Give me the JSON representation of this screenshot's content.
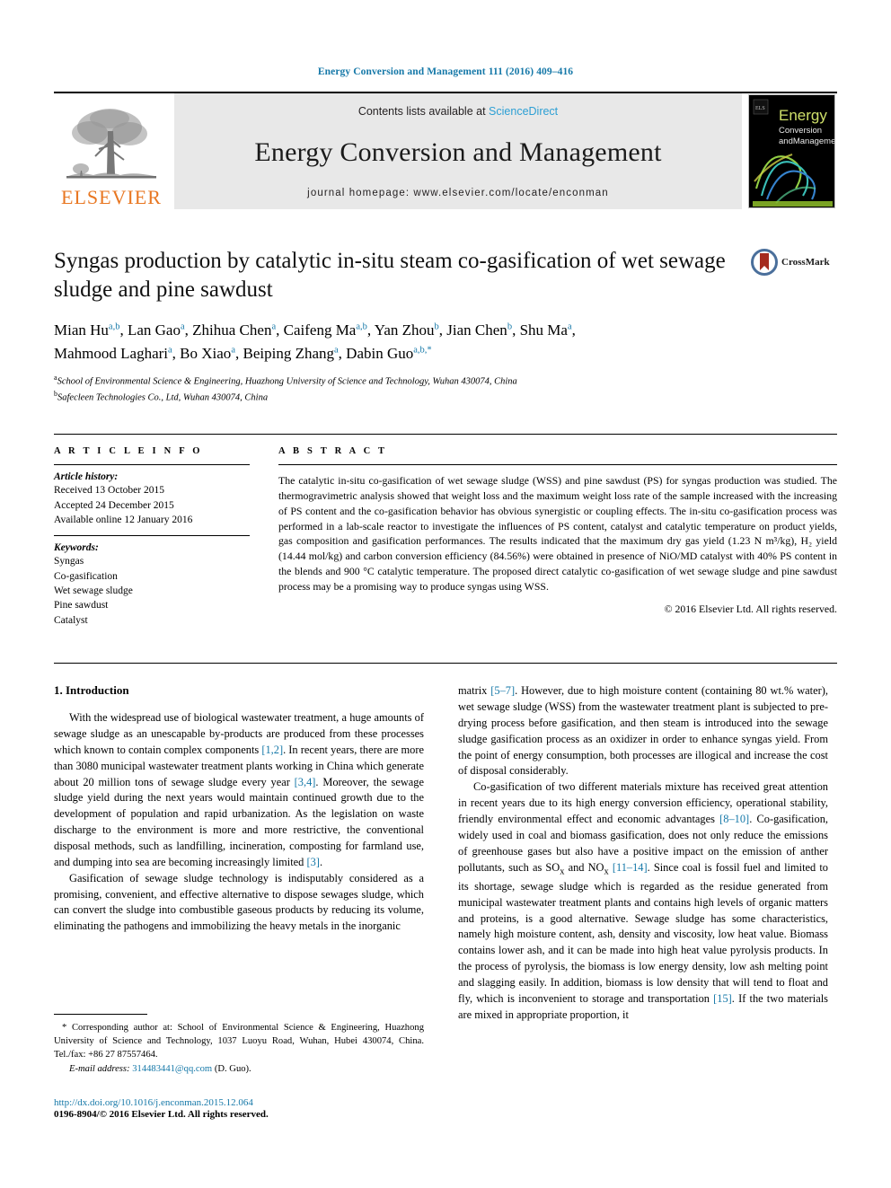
{
  "running_head": "Energy Conversion and Management 111 (2016) 409–416",
  "masthead": {
    "publisher_name": "ELSEVIER",
    "contents_prefix": "Contents lists available at",
    "contents_link": "ScienceDirect",
    "journal_title": "Energy Conversion and Management",
    "homepage_line": "journal homepage: www.elsevier.com/locate/enconman",
    "cover_title_line1": "Energy",
    "cover_title_line2": "Conversion",
    "cover_title_line3": "andManagement"
  },
  "article": {
    "title": "Syngas production by catalytic in-situ steam co-gasification of wet sewage sludge and pine sawdust",
    "crossmark_label": "CrossMark",
    "authors_line1": "Mian Hu a,b, Lan Gao a, Zhihua Chen a, Caifeng Ma a,b, Yan Zhou b, Jian Chen b, Shu Ma a,",
    "authors_line2": "Mahmood Laghari a, Bo Xiao a, Beiping Zhang a, Dabin Guo a,b,*",
    "affiliation_a": "School of Environmental Science & Engineering, Huazhong University of Science and Technology, Wuhan 430074, China",
    "affiliation_b": "Safecleen Technologies Co., Ltd, Wuhan 430074, China"
  },
  "article_info": {
    "heading": "A R T I C L E   I N F O",
    "history_label": "Article history:",
    "history": [
      "Received 13 October 2015",
      "Accepted 24 December 2015",
      "Available online 12 January 2016"
    ],
    "keywords_label": "Keywords:",
    "keywords": [
      "Syngas",
      "Co-gasification",
      "Wet sewage sludge",
      "Pine sawdust",
      "Catalyst"
    ]
  },
  "abstract": {
    "heading": "A B S T R A C T",
    "text": "The catalytic in-situ co-gasification of wet sewage sludge (WSS) and pine sawdust (PS) for syngas production was studied. The thermogravimetric analysis showed that weight loss and the maximum weight loss rate of the sample increased with the increasing of PS content and the co-gasification behavior has obvious synergistic or coupling effects. The in-situ co-gasification process was performed in a lab-scale reactor to investigate the influences of PS content, catalyst and catalytic temperature on product yields, gas composition and gasification performances. The results indicated that the maximum dry gas yield (1.23 N m³/kg), H₂ yield (14.44 mol/kg) and carbon conversion efficiency (84.56%) were obtained in presence of NiO/MD catalyst with 40% PS content in the blends and 900 °C catalytic temperature. The proposed direct catalytic co-gasification of wet sewage sludge and pine sawdust process may be a promising way to produce syngas using WSS.",
    "copyright": "© 2016 Elsevier Ltd. All rights reserved."
  },
  "introduction": {
    "heading": "1. Introduction",
    "left_paragraph_1": "With the widespread use of biological wastewater treatment, a huge amounts of sewage sludge as an unescapable by-products are produced from these processes which known to contain complex components [1,2]. In recent years, there are more than 3080 municipal wastewater treatment plants working in China which generate about 20 million tons of sewage sludge every year [3,4]. Moreover, the sewage sludge yield during the next years would maintain continued growth due to the development of population and rapid urbanization. As the legislation on waste discharge to the environment is more and more restrictive, the conventional disposal methods, such as landfilling, incineration, composting for farmland use, and dumping into sea are becoming increasingly limited [3].",
    "left_paragraph_2": "Gasification of sewage sludge technology is indisputably considered as a promising, convenient, and effective alternative to dispose sewages sludge, which can convert the sludge into combustible gaseous products by reducing its volume, eliminating the pathogens and immobilizing the heavy metals in the inorganic",
    "right_paragraph_1": "matrix [5–7]. However, due to high moisture content (containing 80 wt.% water), wet sewage sludge (WSS) from the wastewater treatment plant is subjected to pre-drying process before gasification, and then steam is introduced into the sewage sludge gasification process as an oxidizer in order to enhance syngas yield. From the point of energy consumption, both processes are illogical and increase the cost of disposal considerably.",
    "right_paragraph_2": "Co-gasification of two different materials mixture has received great attention in recent years due to its high energy conversion efficiency, operational stability, friendly environmental effect and economic advantages [8–10]. Co-gasification, widely used in coal and biomass gasification, does not only reduce the emissions of greenhouse gases but also have a positive impact on the emission of anther pollutants, such as SOx and NOx [11–14]. Since coal is fossil fuel and limited to its shortage, sewage sludge which is regarded as the residue generated from municipal wastewater treatment plants and contains high levels of organic matters and proteins, is a good alternative. Sewage sludge has some characteristics, namely high moisture content, ash, density and viscosity, low heat value. Biomass contains lower ash, and it can be made into high heat value pyrolysis products. In the process of pyrolysis, the biomass is low energy density, low ash melting point and slagging easily. In addition, biomass is low density that will tend to float and fly, which is inconvenient to storage and transportation [15]. If the two materials are mixed in appropriate proportion, it"
  },
  "footnotes": {
    "corresponding": "* Corresponding author at: School of Environmental Science & Engineering, Huazhong University of Science and Technology, 1037 Luoyu Road, Wuhan, Hubei 430074, China. Tel./fax: +86 27 87557464.",
    "email_label": "E-mail address:",
    "email": "314483441@qq.com",
    "email_owner": "(D. Guo).",
    "doi": "http://dx.doi.org/10.1016/j.enconman.2015.12.064",
    "issn": "0196-8904/© 2016 Elsevier Ltd. All rights reserved."
  },
  "colors": {
    "link": "#1578a8",
    "sciencedirect": "#2c9fd4",
    "elsevier_orange": "#e87722",
    "band_gray": "#e8e8e8"
  }
}
